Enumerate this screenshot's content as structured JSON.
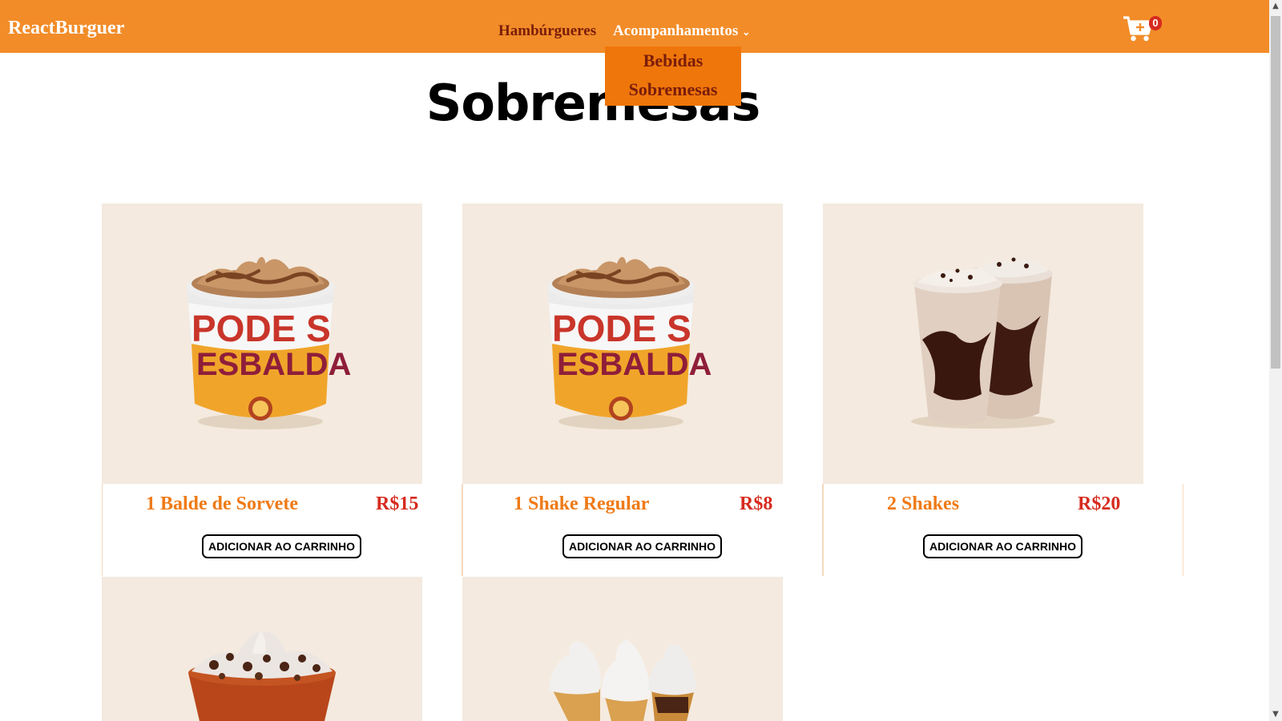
{
  "navbar": {
    "brand": "ReactBurguer",
    "links": {
      "burgers": "Hambúrgueres",
      "sides": "Acompanhamentos"
    },
    "dropdown": [
      "Bebidas",
      "Sobremesas"
    ],
    "cart_count": "0"
  },
  "page": {
    "title": "Sobremesas"
  },
  "products": [
    {
      "name": "1 Balde de Sorvete",
      "price": "R$15",
      "button": "ADICIONAR AO CARRINHO",
      "image": "ice-cream-bucket"
    },
    {
      "name": "1 Shake Regular",
      "price": "R$8",
      "button": "ADICIONAR AO CARRINHO",
      "image": "ice-cream-bucket"
    },
    {
      "name": "2 Shakes",
      "price": "R$20",
      "button": "ADICIONAR AO CARRINHO",
      "image": "two-shakes"
    },
    {
      "image": "sundae-cup"
    },
    {
      "image": "three-cones"
    }
  ],
  "colors": {
    "navbar": "#f28c28",
    "dropdown": "#ef760a",
    "product_name": "#ef7a16",
    "price": "#d62b1e",
    "image_bg": "#f4eadf"
  }
}
